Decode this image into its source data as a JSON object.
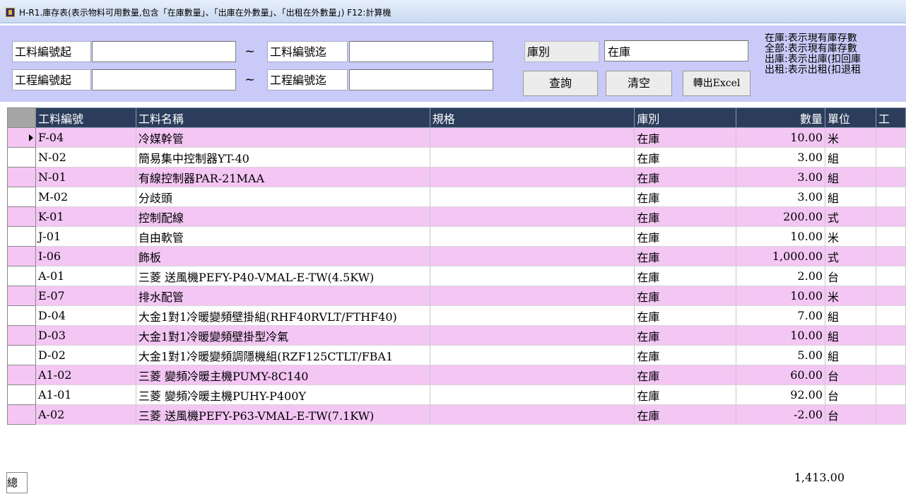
{
  "window": {
    "title": "H-R1.庫存表(表示物料可用數量,包含「在庫數量」、「出庫在外數量」、「出租在外數量」) F12:計算機"
  },
  "filters": {
    "material_from_label": "工料編號起",
    "material_from_value": "",
    "tilde": "~",
    "material_to_label": "工料編號迄",
    "material_to_value": "",
    "project_from_label": "工程編號起",
    "project_from_value": "",
    "project_to_label": "工程編號迄",
    "project_to_value": "",
    "warehouse_label": "庫別",
    "warehouse_value": "在庫"
  },
  "buttons": {
    "query": "查詢",
    "clear": "清空",
    "export": "轉出Excel"
  },
  "legend": [
    "在庫:表示現有庫存數",
    "全部:表示現有庫存數",
    "出庫:表示出庫(扣回庫",
    "出租:表示出租(扣退租"
  ],
  "table": {
    "columns": [
      "工料編號",
      "工料名稱",
      "規格",
      "庫別",
      "數量",
      "單位",
      "工"
    ],
    "rows": [
      [
        "F-04",
        "冷媒幹管",
        "",
        "在庫",
        "10.00",
        "米"
      ],
      [
        "N-02",
        "簡易集中控制器YT-40",
        "",
        "在庫",
        "3.00",
        "組"
      ],
      [
        "N-01",
        "有線控制器PAR-21MAA",
        "",
        "在庫",
        "3.00",
        "組"
      ],
      [
        "M-02",
        "分歧頭",
        "",
        "在庫",
        "3.00",
        "組"
      ],
      [
        "K-01",
        "控制配線",
        "",
        "在庫",
        "200.00",
        "式"
      ],
      [
        "J-01",
        "自由軟管",
        "",
        "在庫",
        "10.00",
        "米"
      ],
      [
        "I-06",
        "飾板",
        "",
        "在庫",
        "1,000.00",
        "式"
      ],
      [
        "A-01",
        "三菱 送風機PEFY-P40-VMAL-E-TW(4.5KW)",
        "",
        "在庫",
        "2.00",
        "台"
      ],
      [
        "E-07",
        "排水配管",
        "",
        "在庫",
        "10.00",
        "米"
      ],
      [
        "D-04",
        "大金1對1冷暖變頻壁掛組(RHF40RVLT/FTHF40)",
        "",
        "在庫",
        "7.00",
        "組"
      ],
      [
        "D-03",
        "大金1對1冷暖變頻壁掛型冷氣",
        "",
        "在庫",
        "10.00",
        "組"
      ],
      [
        "D-02",
        "大金1對1冷暖變頻調隱機組(RZF125CTLT/FBA1",
        "",
        "在庫",
        "5.00",
        "組"
      ],
      [
        "A1-02",
        "三菱 變頻冷暖主機PUMY-8C140",
        "",
        "在庫",
        "60.00",
        "台"
      ],
      [
        "A1-01",
        "三菱 變頻冷暖主機PUHY-P400Y",
        "",
        "在庫",
        "92.00",
        "台"
      ],
      [
        "A-02",
        "三菱 送風機PEFY-P63-VMAL-E-TW(7.1KW)",
        "",
        "在庫",
        "-2.00",
        "台"
      ]
    ]
  },
  "total": {
    "label": "總計",
    "value": "1,413.00"
  }
}
